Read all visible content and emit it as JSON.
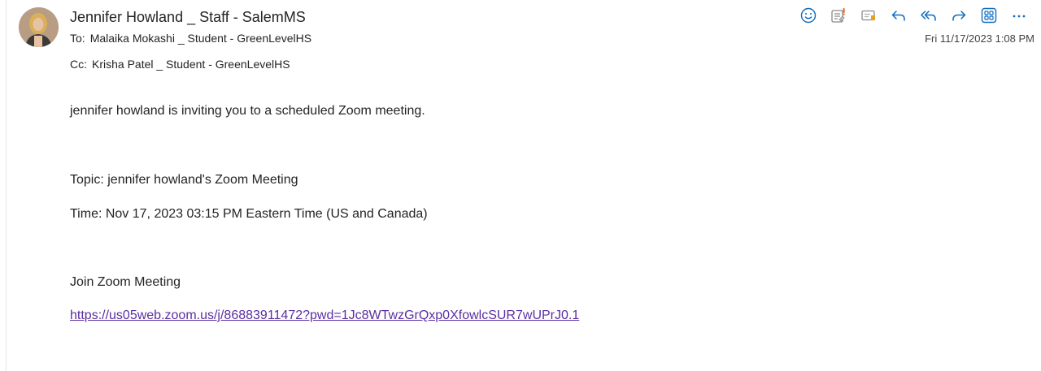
{
  "header": {
    "sender": "Jennifer Howland _ Staff - SalemMS",
    "to_label": "To:",
    "to_value": "Malaika Mokashi _ Student - GreenLevelHS",
    "cc_label": "Cc:",
    "cc_value": "Krisha Patel _ Student - GreenLevelHS",
    "date": "Fri 11/17/2023 1:08 PM"
  },
  "toolbar": {
    "icons": [
      "emoji-icon",
      "sensitivity-icon",
      "mark-icon",
      "reply-icon",
      "reply-all-icon",
      "forward-icon",
      "apps-icon",
      "more-icon"
    ]
  },
  "colors": {
    "accent": "#0f6cbd",
    "link": "#5b2fa0",
    "text": "#242424"
  },
  "body": {
    "intro": "jennifer howland is inviting you to a scheduled Zoom meeting.",
    "topic": "Topic: jennifer howland's Zoom Meeting",
    "time": "Time: Nov 17, 2023 03:15 PM Eastern Time (US and Canada)",
    "join": "Join Zoom Meeting",
    "link": "https://us05web.zoom.us/j/86883911472?pwd=1Jc8WTwzGrQxp0XfowlcSUR7wUPrJ0.1"
  }
}
